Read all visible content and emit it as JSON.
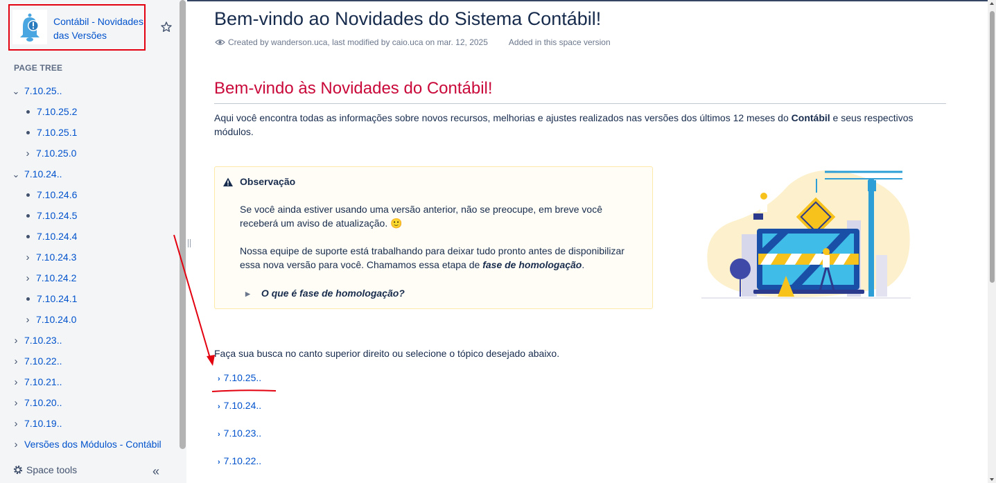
{
  "space": {
    "name": "Contábil - Novidades das Versões"
  },
  "sidebar": {
    "heading": "PAGE TREE",
    "items": [
      {
        "label": "7.10.25..",
        "kind": "expanded"
      },
      {
        "label": "7.10.25.2",
        "kind": "leaf"
      },
      {
        "label": "7.10.25.1",
        "kind": "leaf"
      },
      {
        "label": "7.10.25.0",
        "kind": "collapsed"
      },
      {
        "label": "7.10.24..",
        "kind": "expanded"
      },
      {
        "label": "7.10.24.6",
        "kind": "leaf"
      },
      {
        "label": "7.10.24.5",
        "kind": "leaf"
      },
      {
        "label": "7.10.24.4",
        "kind": "leaf"
      },
      {
        "label": "7.10.24.3",
        "kind": "collapsed"
      },
      {
        "label": "7.10.24.2",
        "kind": "collapsed"
      },
      {
        "label": "7.10.24.1",
        "kind": "leaf"
      },
      {
        "label": "7.10.24.0",
        "kind": "collapsed"
      },
      {
        "label": "7.10.23..",
        "kind": "collapsed"
      },
      {
        "label": "7.10.22..",
        "kind": "collapsed"
      },
      {
        "label": "7.10.21..",
        "kind": "collapsed"
      },
      {
        "label": "7.10.20..",
        "kind": "collapsed"
      },
      {
        "label": "7.10.19..",
        "kind": "collapsed"
      },
      {
        "label": "Versões dos Módulos - Contábil",
        "kind": "collapsed"
      }
    ],
    "space_tools": "Space tools",
    "collapse_glyph": "«"
  },
  "page": {
    "title": "Bem-vindo ao Novidades do Sistema Contábil!",
    "meta": "Created by wanderson.uca, last modified by caio.uca on mar. 12, 2025",
    "added": "Added in this space version",
    "section_heading": "Bem-vindo às Novidades do Contábil!",
    "intro_before": "Aqui você encontra todas as informações sobre novos recursos, melhorias e ajustes realizados nas versões dos últimos 12 meses do ",
    "intro_bold": "Contábil",
    "intro_after": " e seus respectivos módulos.",
    "note": {
      "title": "Observação",
      "p1": "Se você ainda estiver usando uma versão anterior, não se preocupe, em breve você receberá um aviso de atualização.",
      "emoji": "🙂",
      "p2_before": "Nossa equipe de suporte está trabalhando para deixar tudo pronto antes de disponibilizar essa nova versão para você. Chamamos essa etapa de ",
      "p2_bold": "fase de homologação",
      "p2_after": ".",
      "expand": "O que é fase de homologação?"
    },
    "search_hint": "Faça sua busca no canto superior direito ou selecione o tópico desejado abaixo.",
    "children": [
      "7.10.25..",
      "7.10.24..",
      "7.10.23..",
      "7.10.22.."
    ]
  },
  "colors": {
    "link": "#0052cc",
    "heading_red": "#c9093a",
    "annotation_red": "#e3000f",
    "note_bg": "#fffdf5"
  }
}
